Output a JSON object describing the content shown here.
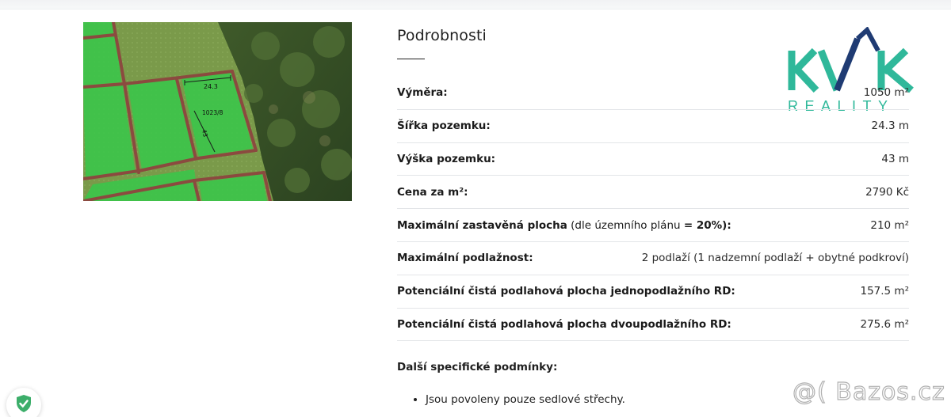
{
  "map": {
    "parcel_width_label": "24.3",
    "parcel_id_label": "1023/8",
    "parcel_height_label": "43"
  },
  "logo": {
    "letters": "KVK",
    "subtitle": "REALITY",
    "colors": {
      "teal": "#2fb89a",
      "navy": "#1f3b73"
    }
  },
  "details": {
    "heading": "Podrobnosti",
    "rows": [
      {
        "label": "Výměra:",
        "value": "1050 m²"
      },
      {
        "label": "Šířka pozemku:",
        "value": "24.3 m"
      },
      {
        "label": "Výška pozemku:",
        "value": "43 m"
      },
      {
        "label": "Cena za m²:",
        "value": "2790 Kč"
      },
      {
        "label": "Maximální zastavěná plocha",
        "label_note": " (dle územního plánu ",
        "label_bold_tail": "= 20%",
        "label_end": "):",
        "value": "210 m²"
      },
      {
        "label": "Maximální podlažnost:",
        "value": "2 podlaží (1 nadzemní podlaží + obytné podkroví)"
      },
      {
        "label": "Potenciální čistá podlahová plocha jednopodlažního RD:",
        "value": "157.5 m²"
      },
      {
        "label": "Potenciální čistá podlahová plocha dvoupodlažního RD:",
        "value": "275.6 m²"
      }
    ],
    "extra_heading": "Další specifické podmínky:",
    "bullets": [
      "Jsou povoleny pouze sedlové střechy."
    ]
  },
  "watermark": "@( Bazos.cz"
}
